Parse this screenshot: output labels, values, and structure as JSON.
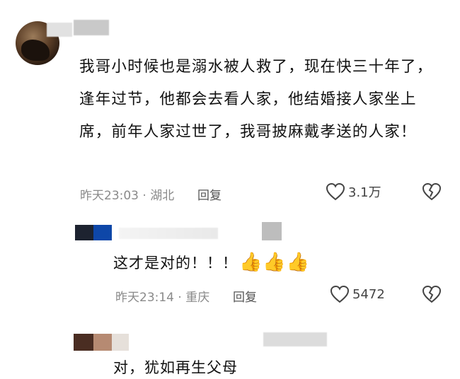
{
  "comments": [
    {
      "text": "我哥小时候也是溺水被人救了，现在快三十年了，逢年过节，他都会去看人家，他结婚接人家坐上席，前年人家过世了，我哥披麻戴孝送的人家！",
      "time_location": "昨天23:03 · 湖北",
      "reply_label": "回复",
      "likes": "3.1万"
    }
  ],
  "replies": [
    {
      "text": "这才是对的！！！",
      "emoji": "👍👍👍",
      "time_location": "昨天23:14 · 重庆",
      "reply_label": "回复",
      "likes": "5472"
    },
    {
      "text": "对，犹如再生父母"
    }
  ],
  "icons": {
    "like": "heart-outline-icon",
    "dislike": "broken-heart-icon"
  }
}
